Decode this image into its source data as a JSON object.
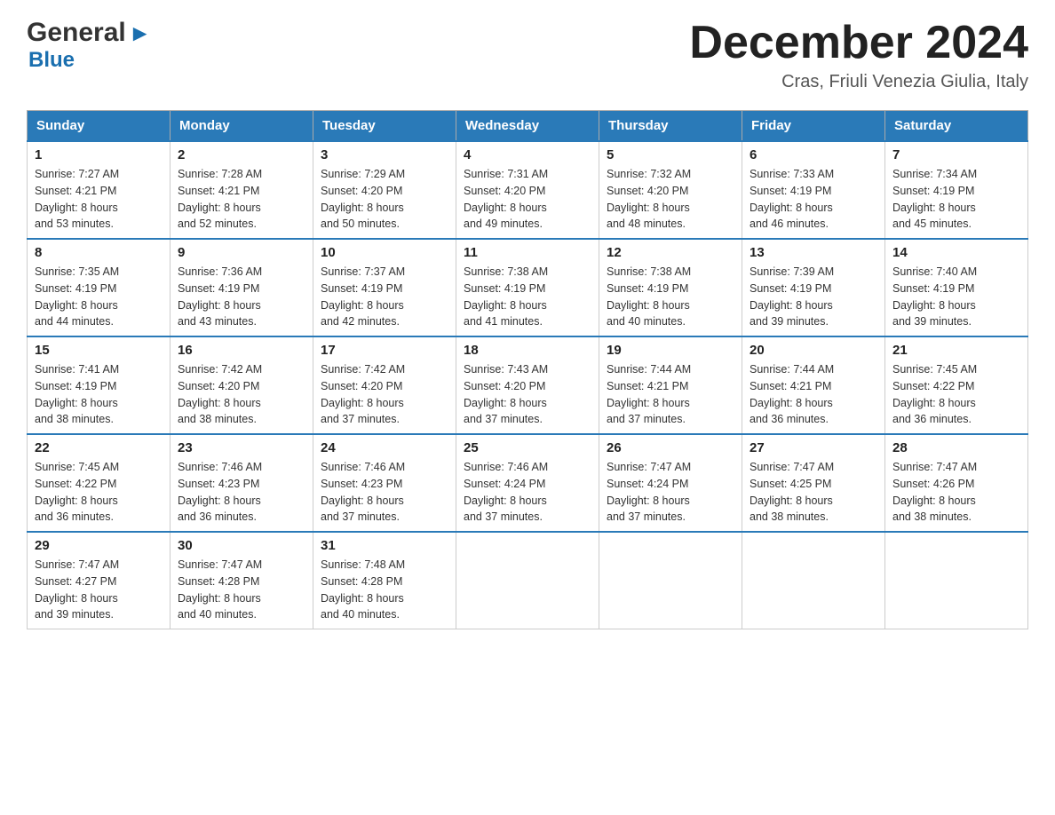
{
  "logo": {
    "text1": "General",
    "arrow": "▶",
    "text2": "Blue"
  },
  "header": {
    "month_year": "December 2024",
    "location": "Cras, Friuli Venezia Giulia, Italy"
  },
  "weekdays": [
    "Sunday",
    "Monday",
    "Tuesday",
    "Wednesday",
    "Thursday",
    "Friday",
    "Saturday"
  ],
  "weeks": [
    [
      {
        "day": "1",
        "sunrise": "7:27 AM",
        "sunset": "4:21 PM",
        "daylight": "8 hours and 53 minutes."
      },
      {
        "day": "2",
        "sunrise": "7:28 AM",
        "sunset": "4:21 PM",
        "daylight": "8 hours and 52 minutes."
      },
      {
        "day": "3",
        "sunrise": "7:29 AM",
        "sunset": "4:20 PM",
        "daylight": "8 hours and 50 minutes."
      },
      {
        "day": "4",
        "sunrise": "7:31 AM",
        "sunset": "4:20 PM",
        "daylight": "8 hours and 49 minutes."
      },
      {
        "day": "5",
        "sunrise": "7:32 AM",
        "sunset": "4:20 PM",
        "daylight": "8 hours and 48 minutes."
      },
      {
        "day": "6",
        "sunrise": "7:33 AM",
        "sunset": "4:19 PM",
        "daylight": "8 hours and 46 minutes."
      },
      {
        "day": "7",
        "sunrise": "7:34 AM",
        "sunset": "4:19 PM",
        "daylight": "8 hours and 45 minutes."
      }
    ],
    [
      {
        "day": "8",
        "sunrise": "7:35 AM",
        "sunset": "4:19 PM",
        "daylight": "8 hours and 44 minutes."
      },
      {
        "day": "9",
        "sunrise": "7:36 AM",
        "sunset": "4:19 PM",
        "daylight": "8 hours and 43 minutes."
      },
      {
        "day": "10",
        "sunrise": "7:37 AM",
        "sunset": "4:19 PM",
        "daylight": "8 hours and 42 minutes."
      },
      {
        "day": "11",
        "sunrise": "7:38 AM",
        "sunset": "4:19 PM",
        "daylight": "8 hours and 41 minutes."
      },
      {
        "day": "12",
        "sunrise": "7:38 AM",
        "sunset": "4:19 PM",
        "daylight": "8 hours and 40 minutes."
      },
      {
        "day": "13",
        "sunrise": "7:39 AM",
        "sunset": "4:19 PM",
        "daylight": "8 hours and 39 minutes."
      },
      {
        "day": "14",
        "sunrise": "7:40 AM",
        "sunset": "4:19 PM",
        "daylight": "8 hours and 39 minutes."
      }
    ],
    [
      {
        "day": "15",
        "sunrise": "7:41 AM",
        "sunset": "4:19 PM",
        "daylight": "8 hours and 38 minutes."
      },
      {
        "day": "16",
        "sunrise": "7:42 AM",
        "sunset": "4:20 PM",
        "daylight": "8 hours and 38 minutes."
      },
      {
        "day": "17",
        "sunrise": "7:42 AM",
        "sunset": "4:20 PM",
        "daylight": "8 hours and 37 minutes."
      },
      {
        "day": "18",
        "sunrise": "7:43 AM",
        "sunset": "4:20 PM",
        "daylight": "8 hours and 37 minutes."
      },
      {
        "day": "19",
        "sunrise": "7:44 AM",
        "sunset": "4:21 PM",
        "daylight": "8 hours and 37 minutes."
      },
      {
        "day": "20",
        "sunrise": "7:44 AM",
        "sunset": "4:21 PM",
        "daylight": "8 hours and 36 minutes."
      },
      {
        "day": "21",
        "sunrise": "7:45 AM",
        "sunset": "4:22 PM",
        "daylight": "8 hours and 36 minutes."
      }
    ],
    [
      {
        "day": "22",
        "sunrise": "7:45 AM",
        "sunset": "4:22 PM",
        "daylight": "8 hours and 36 minutes."
      },
      {
        "day": "23",
        "sunrise": "7:46 AM",
        "sunset": "4:23 PM",
        "daylight": "8 hours and 36 minutes."
      },
      {
        "day": "24",
        "sunrise": "7:46 AM",
        "sunset": "4:23 PM",
        "daylight": "8 hours and 37 minutes."
      },
      {
        "day": "25",
        "sunrise": "7:46 AM",
        "sunset": "4:24 PM",
        "daylight": "8 hours and 37 minutes."
      },
      {
        "day": "26",
        "sunrise": "7:47 AM",
        "sunset": "4:24 PM",
        "daylight": "8 hours and 37 minutes."
      },
      {
        "day": "27",
        "sunrise": "7:47 AM",
        "sunset": "4:25 PM",
        "daylight": "8 hours and 38 minutes."
      },
      {
        "day": "28",
        "sunrise": "7:47 AM",
        "sunset": "4:26 PM",
        "daylight": "8 hours and 38 minutes."
      }
    ],
    [
      {
        "day": "29",
        "sunrise": "7:47 AM",
        "sunset": "4:27 PM",
        "daylight": "8 hours and 39 minutes."
      },
      {
        "day": "30",
        "sunrise": "7:47 AM",
        "sunset": "4:28 PM",
        "daylight": "8 hours and 40 minutes."
      },
      {
        "day": "31",
        "sunrise": "7:48 AM",
        "sunset": "4:28 PM",
        "daylight": "8 hours and 40 minutes."
      },
      null,
      null,
      null,
      null
    ]
  ],
  "labels": {
    "sunrise": "Sunrise:",
    "sunset": "Sunset:",
    "daylight": "Daylight:"
  }
}
